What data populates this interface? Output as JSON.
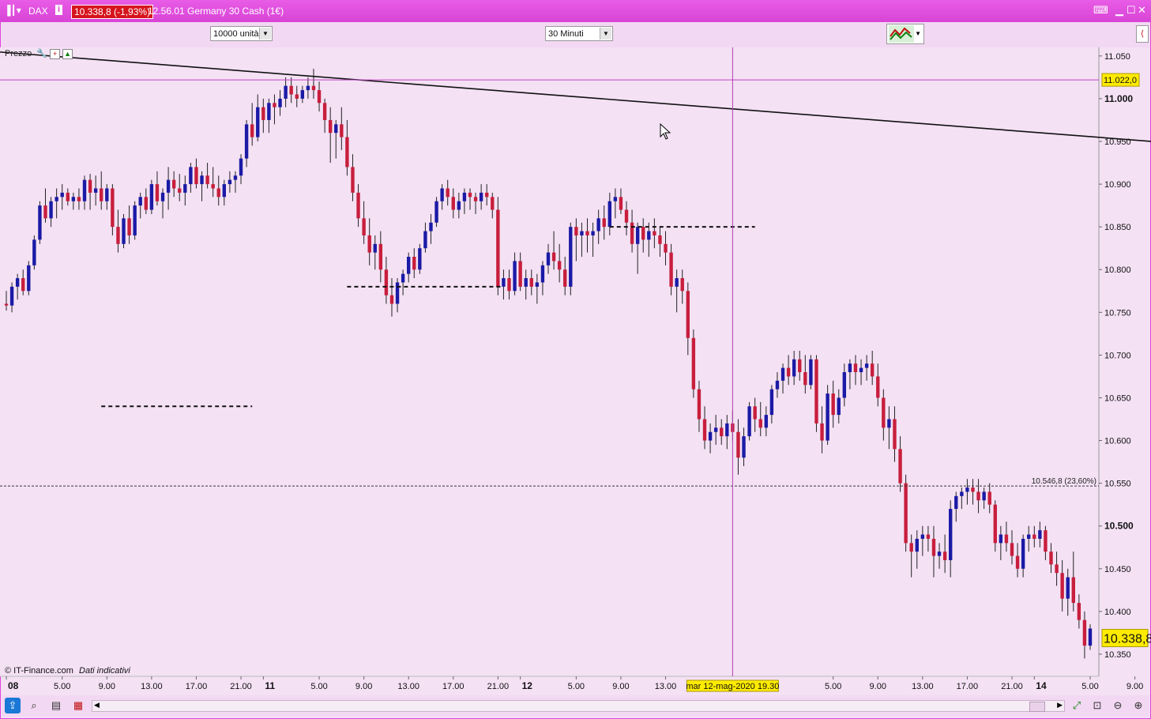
{
  "window": {
    "symbol": "DAX",
    "last_price": "10.338,8 (-1,93%)",
    "info_text": "12.56.01 Germany 30 Cash (1€)"
  },
  "toolbar": {
    "units_select": "10000 unità",
    "timeframe_select": "30 Minuti"
  },
  "legend": {
    "label": "Prezzo"
  },
  "footer": {
    "copyright": "© IT-Finance.com",
    "note": "Dati indicativi"
  },
  "crosshair_label": "mar 12-mag-2020 19.30",
  "price_tag_top": "11.022,0",
  "price_tag_last": "10.338,8",
  "fib_label": "10.546,8 (23,60%)",
  "colors": {
    "bull": "#1a1aa6",
    "bear": "#c81e3c",
    "bg": "#f4e1f4",
    "titlebar": "#e050e0"
  },
  "chart_data": {
    "type": "candlestick",
    "y_ticks": [
      "11.050",
      "11.000",
      "10.950",
      "10.900",
      "10.850",
      "10.800",
      "10.750",
      "10.700",
      "10.650",
      "10.600",
      "10.550",
      "10.500",
      "10.450",
      "10.400",
      "10.350"
    ],
    "y_ticks_bold": [
      "11.000",
      "10.500"
    ],
    "ylim": [
      10325,
      11060
    ],
    "x_ticks": [
      {
        "label": "08",
        "bold": true,
        "i": 0
      },
      {
        "label": "5.00",
        "i": 10
      },
      {
        "label": "9.00",
        "i": 18
      },
      {
        "label": "13.00",
        "i": 26
      },
      {
        "label": "17.00",
        "i": 34
      },
      {
        "label": "21.00",
        "i": 42
      },
      {
        "label": "11",
        "bold": true,
        "i": 46
      },
      {
        "label": "5.00",
        "i": 56
      },
      {
        "label": "9.00",
        "i": 64
      },
      {
        "label": "13.00",
        "i": 72
      },
      {
        "label": "17.00",
        "i": 80
      },
      {
        "label": "21.00",
        "i": 88
      },
      {
        "label": "12",
        "bold": true,
        "i": 92
      },
      {
        "label": "5.00",
        "i": 102
      },
      {
        "label": "9.00",
        "i": 110
      },
      {
        "label": "13.00",
        "i": 118
      },
      {
        "label": "5.00",
        "i": 148
      },
      {
        "label": "9.00",
        "i": 156
      },
      {
        "label": "13.00",
        "i": 164
      },
      {
        "label": "17.00",
        "i": 172
      },
      {
        "label": "21.00",
        "i": 180
      },
      {
        "label": "14",
        "bold": true,
        "i": 184
      },
      {
        "label": "5.00",
        "i": 194
      },
      {
        "label": "9.00",
        "i": 202
      }
    ],
    "ohlc": [
      [
        10760,
        10775,
        10752,
        10758
      ],
      [
        10758,
        10785,
        10750,
        10780
      ],
      [
        10780,
        10795,
        10765,
        10790
      ],
      [
        10790,
        10800,
        10770,
        10775
      ],
      [
        10775,
        10810,
        10770,
        10805
      ],
      [
        10805,
        10840,
        10800,
        10835
      ],
      [
        10835,
        10880,
        10830,
        10875
      ],
      [
        10875,
        10895,
        10855,
        10860
      ],
      [
        10860,
        10885,
        10850,
        10880
      ],
      [
        10880,
        10895,
        10860,
        10885
      ],
      [
        10885,
        10900,
        10870,
        10890
      ],
      [
        10890,
        10895,
        10875,
        10880
      ],
      [
        10880,
        10890,
        10870,
        10885
      ],
      [
        10885,
        10895,
        10870,
        10880
      ],
      [
        10880,
        10910,
        10870,
        10905
      ],
      [
        10905,
        10912,
        10870,
        10890
      ],
      [
        10890,
        10910,
        10875,
        10895
      ],
      [
        10895,
        10915,
        10870,
        10880
      ],
      [
        10880,
        10900,
        10870,
        10895
      ],
      [
        10895,
        10900,
        10840,
        10850
      ],
      [
        10850,
        10870,
        10820,
        10830
      ],
      [
        10830,
        10865,
        10825,
        10860
      ],
      [
        10860,
        10875,
        10830,
        10840
      ],
      [
        10840,
        10880,
        10835,
        10875
      ],
      [
        10875,
        10890,
        10860,
        10885
      ],
      [
        10885,
        10895,
        10865,
        10870
      ],
      [
        10870,
        10905,
        10865,
        10900
      ],
      [
        10900,
        10915,
        10875,
        10880
      ],
      [
        10880,
        10895,
        10860,
        10890
      ],
      [
        10890,
        10920,
        10870,
        10905
      ],
      [
        10905,
        10915,
        10885,
        10895
      ],
      [
        10895,
        10912,
        10880,
        10890
      ],
      [
        10890,
        10910,
        10875,
        10900
      ],
      [
        10900,
        10925,
        10890,
        10920
      ],
      [
        10920,
        10930,
        10895,
        10900
      ],
      [
        10900,
        10915,
        10880,
        10910
      ],
      [
        10910,
        10925,
        10895,
        10900
      ],
      [
        10900,
        10920,
        10885,
        10895
      ],
      [
        10895,
        10910,
        10875,
        10885
      ],
      [
        10885,
        10905,
        10875,
        10900
      ],
      [
        10900,
        10915,
        10890,
        10905
      ],
      [
        10905,
        10915,
        10890,
        10910
      ],
      [
        10910,
        10935,
        10900,
        10930
      ],
      [
        10930,
        10975,
        10920,
        10970
      ],
      [
        10970,
        10995,
        10945,
        10955
      ],
      [
        10955,
        11005,
        10950,
        10990
      ],
      [
        10990,
        11000,
        10960,
        10975
      ],
      [
        10975,
        11000,
        10960,
        10995
      ],
      [
        10995,
        11005,
        10970,
        10990
      ],
      [
        10990,
        11010,
        10980,
        11000
      ],
      [
        11000,
        11025,
        10990,
        11015
      ],
      [
        11015,
        11025,
        10995,
        11005
      ],
      [
        11005,
        11015,
        10990,
        11000
      ],
      [
        11000,
        11015,
        10995,
        11010
      ],
      [
        11010,
        11025,
        11000,
        11015
      ],
      [
        11015,
        11035,
        11000,
        11010
      ],
      [
        11010,
        11020,
        10985,
        10995
      ],
      [
        10995,
        11000,
        10960,
        10975
      ],
      [
        10975,
        10990,
        10925,
        10960
      ],
      [
        10960,
        10975,
        10930,
        10970
      ],
      [
        10970,
        10990,
        10940,
        10955
      ],
      [
        10955,
        10975,
        10910,
        10920
      ],
      [
        10920,
        10935,
        10880,
        10890
      ],
      [
        10890,
        10900,
        10850,
        10860
      ],
      [
        10860,
        10880,
        10830,
        10840
      ],
      [
        10840,
        10860,
        10805,
        10820
      ],
      [
        10820,
        10840,
        10800,
        10830
      ],
      [
        10830,
        10845,
        10785,
        10800
      ],
      [
        10800,
        10815,
        10760,
        10770
      ],
      [
        10770,
        10790,
        10745,
        10760
      ],
      [
        10760,
        10790,
        10750,
        10785
      ],
      [
        10785,
        10800,
        10770,
        10795
      ],
      [
        10795,
        10820,
        10785,
        10815
      ],
      [
        10815,
        10825,
        10790,
        10800
      ],
      [
        10800,
        10830,
        10795,
        10825
      ],
      [
        10825,
        10855,
        10820,
        10845
      ],
      [
        10845,
        10865,
        10830,
        10855
      ],
      [
        10855,
        10885,
        10850,
        10880
      ],
      [
        10880,
        10900,
        10870,
        10895
      ],
      [
        10895,
        10905,
        10875,
        10885
      ],
      [
        10885,
        10895,
        10860,
        10870
      ],
      [
        10870,
        10890,
        10860,
        10880
      ],
      [
        10880,
        10895,
        10865,
        10890
      ],
      [
        10890,
        10895,
        10870,
        10885
      ],
      [
        10885,
        10890,
        10865,
        10880
      ],
      [
        10880,
        10900,
        10870,
        10890
      ],
      [
        10890,
        10900,
        10875,
        10885
      ],
      [
        10885,
        10890,
        10860,
        10870
      ],
      [
        10870,
        10885,
        10770,
        10780
      ],
      [
        10780,
        10800,
        10765,
        10790
      ],
      [
        10790,
        10800,
        10765,
        10775
      ],
      [
        10775,
        10820,
        10770,
        10810
      ],
      [
        10810,
        10820,
        10775,
        10780
      ],
      [
        10780,
        10800,
        10765,
        10790
      ],
      [
        10790,
        10800,
        10770,
        10780
      ],
      [
        10780,
        10795,
        10760,
        10785
      ],
      [
        10785,
        10810,
        10770,
        10805
      ],
      [
        10805,
        10830,
        10795,
        10820
      ],
      [
        10820,
        10845,
        10800,
        10810
      ],
      [
        10810,
        10830,
        10785,
        10800
      ],
      [
        10800,
        10815,
        10770,
        10780
      ],
      [
        10780,
        10855,
        10770,
        10850
      ],
      [
        10850,
        10860,
        10810,
        10840
      ],
      [
        10840,
        10855,
        10815,
        10845
      ],
      [
        10845,
        10860,
        10820,
        10840
      ],
      [
        10840,
        10855,
        10815,
        10845
      ],
      [
        10845,
        10870,
        10830,
        10860
      ],
      [
        10860,
        10875,
        10835,
        10850
      ],
      [
        10850,
        10890,
        10840,
        10880
      ],
      [
        10880,
        10895,
        10860,
        10885
      ],
      [
        10885,
        10895,
        10865,
        10870
      ],
      [
        10870,
        10880,
        10840,
        10855
      ],
      [
        10855,
        10870,
        10820,
        10830
      ],
      [
        10830,
        10855,
        10795,
        10850
      ],
      [
        10850,
        10860,
        10820,
        10835
      ],
      [
        10835,
        10855,
        10815,
        10845
      ],
      [
        10845,
        10860,
        10825,
        10840
      ],
      [
        10840,
        10850,
        10815,
        10830
      ],
      [
        10830,
        10845,
        10805,
        10820
      ],
      [
        10820,
        10830,
        10770,
        10780
      ],
      [
        10780,
        10800,
        10750,
        10790
      ],
      [
        10790,
        10800,
        10760,
        10775
      ],
      [
        10775,
        10785,
        10700,
        10720
      ],
      [
        10720,
        10730,
        10650,
        10660
      ],
      [
        10660,
        10670,
        10610,
        10625
      ],
      [
        10625,
        10640,
        10590,
        10600
      ],
      [
        10600,
        10620,
        10585,
        10610
      ],
      [
        10610,
        10630,
        10595,
        10615
      ],
      [
        10615,
        10625,
        10595,
        10605
      ],
      [
        10605,
        10630,
        10590,
        10620
      ],
      [
        10620,
        10635,
        10600,
        10610
      ],
      [
        10610,
        10625,
        10560,
        10580
      ],
      [
        10580,
        10615,
        10570,
        10605
      ],
      [
        10605,
        10645,
        10600,
        10640
      ],
      [
        10640,
        10650,
        10610,
        10625
      ],
      [
        10625,
        10645,
        10605,
        10615
      ],
      [
        10615,
        10640,
        10605,
        10630
      ],
      [
        10630,
        10665,
        10620,
        10660
      ],
      [
        10660,
        10680,
        10650,
        10670
      ],
      [
        10670,
        10690,
        10655,
        10685
      ],
      [
        10685,
        10700,
        10665,
        10675
      ],
      [
        10675,
        10705,
        10665,
        10695
      ],
      [
        10695,
        10705,
        10670,
        10680
      ],
      [
        10680,
        10700,
        10655,
        10665
      ],
      [
        10665,
        10700,
        10660,
        10695
      ],
      [
        10695,
        10700,
        10610,
        10620
      ],
      [
        10620,
        10640,
        10585,
        10600
      ],
      [
        10600,
        10665,
        10595,
        10655
      ],
      [
        10655,
        10670,
        10615,
        10630
      ],
      [
        10630,
        10660,
        10620,
        10650
      ],
      [
        10650,
        10690,
        10640,
        10680
      ],
      [
        10680,
        10695,
        10660,
        10690
      ],
      [
        10690,
        10700,
        10665,
        10680
      ],
      [
        10680,
        10695,
        10665,
        10685
      ],
      [
        10685,
        10700,
        10670,
        10690
      ],
      [
        10690,
        10705,
        10665,
        10675
      ],
      [
        10675,
        10690,
        10640,
        10650
      ],
      [
        10650,
        10660,
        10600,
        10615
      ],
      [
        10615,
        10640,
        10590,
        10625
      ],
      [
        10625,
        10640,
        10575,
        10590
      ],
      [
        10590,
        10605,
        10540,
        10550
      ],
      [
        10550,
        10560,
        10470,
        10480
      ],
      [
        10480,
        10490,
        10440,
        10470
      ],
      [
        10470,
        10495,
        10450,
        10485
      ],
      [
        10485,
        10500,
        10465,
        10490
      ],
      [
        10490,
        10500,
        10470,
        10485
      ],
      [
        10485,
        10500,
        10440,
        10465
      ],
      [
        10465,
        10480,
        10450,
        10470
      ],
      [
        10470,
        10490,
        10445,
        10460
      ],
      [
        10460,
        10530,
        10440,
        10520
      ],
      [
        10520,
        10540,
        10505,
        10535
      ],
      [
        10535,
        10545,
        10520,
        10540
      ],
      [
        10540,
        10555,
        10525,
        10545
      ],
      [
        10545,
        10555,
        10525,
        10540
      ],
      [
        10540,
        10555,
        10515,
        10530
      ],
      [
        10530,
        10545,
        10520,
        10540
      ],
      [
        10540,
        10550,
        10515,
        10525
      ],
      [
        10525,
        10530,
        10470,
        10480
      ],
      [
        10480,
        10500,
        10460,
        10490
      ],
      [
        10490,
        10505,
        10470,
        10480
      ],
      [
        10480,
        10495,
        10455,
        10465
      ],
      [
        10465,
        10480,
        10440,
        10450
      ],
      [
        10450,
        10490,
        10440,
        10485
      ],
      [
        10485,
        10500,
        10470,
        10490
      ],
      [
        10490,
        10500,
        10475,
        10485
      ],
      [
        10485,
        10505,
        10475,
        10495
      ],
      [
        10495,
        10500,
        10460,
        10470
      ],
      [
        10470,
        10480,
        10445,
        10455
      ],
      [
        10455,
        10470,
        10430,
        10445
      ],
      [
        10445,
        10460,
        10400,
        10415
      ],
      [
        10415,
        10450,
        10395,
        10440
      ],
      [
        10440,
        10470,
        10400,
        10410
      ],
      [
        10410,
        10420,
        10380,
        10390
      ],
      [
        10390,
        10400,
        10345,
        10360
      ],
      [
        10360,
        10385,
        10355,
        10380
      ]
    ],
    "drawings": {
      "trendline": [
        {
          "i": -2,
          "p": 11055
        },
        {
          "i": 205,
          "p": 10950
        }
      ],
      "h_dashed": [
        {
          "i0": 17,
          "i1": 44,
          "p": 10640
        },
        {
          "i0": 61,
          "i1": 89,
          "p": 10780
        },
        {
          "i0": 108,
          "i1": 134,
          "p": 10850
        }
      ],
      "h_line_top": 11022,
      "fib_dashed": 10546.8,
      "crosshair_i": 130
    }
  }
}
